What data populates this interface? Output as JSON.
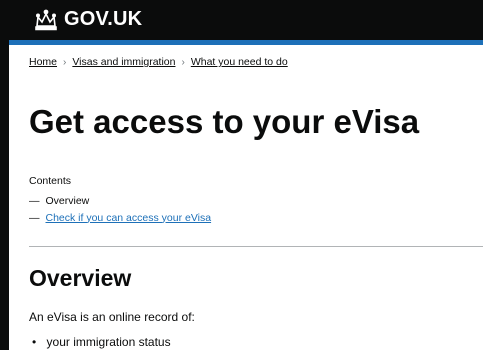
{
  "header": {
    "logo_text": "GOV.UK",
    "bg_color": "#0b0c0c",
    "stripe_color": "#1d70b8",
    "logo_icon": "crown-icon"
  },
  "breadcrumb": {
    "items": [
      "Home",
      "Visas and immigration",
      "What you need to do"
    ],
    "separator_icon": "chevron-right-icon"
  },
  "page": {
    "title": "Get access to your eVisa"
  },
  "contents": {
    "label": "Contents",
    "items": [
      {
        "label": "Overview",
        "link": false
      },
      {
        "label": "Check if you can access your eVisa",
        "link": true
      }
    ],
    "link_color": "#1d70b8"
  },
  "section": {
    "heading": "Overview",
    "paragraph": "An eVisa is an online record of:",
    "bullets": [
      "your immigration status"
    ]
  }
}
